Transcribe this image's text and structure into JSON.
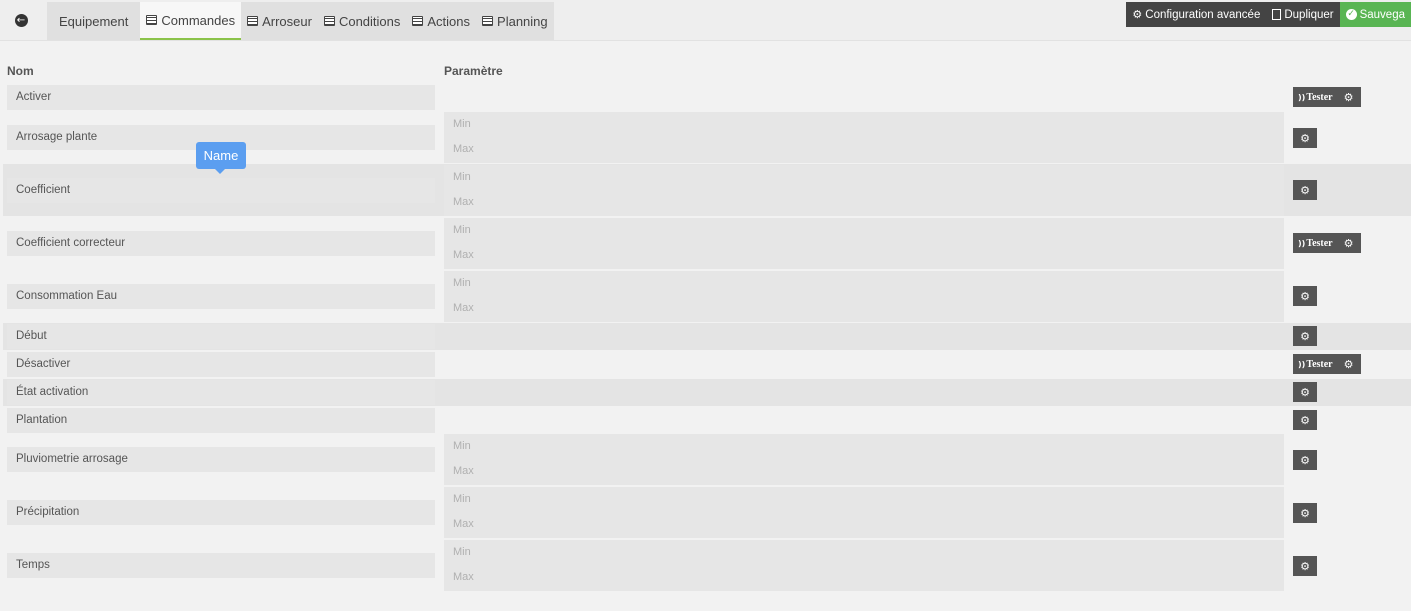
{
  "topbar": {
    "tabs": [
      {
        "label": "Equipement"
      },
      {
        "label": "Commandes"
      },
      {
        "label": "Arroseur"
      },
      {
        "label": "Conditions"
      },
      {
        "label": "Actions"
      },
      {
        "label": "Planning"
      }
    ],
    "buttons": {
      "config": "Configuration avancée",
      "duplicate": "Dupliquer",
      "save": "Sauvega"
    }
  },
  "table": {
    "col_name": "Nom",
    "col_param": "Paramètre",
    "test_label": "Tester",
    "min_placeholder": "Min",
    "max_placeholder": "Max",
    "rows": [
      {
        "name": "Activer"
      },
      {
        "name": "Arrosage plante"
      },
      {
        "name": "Coefficient"
      },
      {
        "name": "Coefficient correcteur"
      },
      {
        "name": "Consommation Eau"
      },
      {
        "name": "Début"
      },
      {
        "name": "Désactiver"
      },
      {
        "name": "État activation"
      },
      {
        "name": "Plantation"
      },
      {
        "name": "Pluviometrie arrosage"
      },
      {
        "name": "Précipitation"
      },
      {
        "name": "Temps"
      }
    ]
  },
  "tooltip": {
    "text": "Name"
  },
  "colors": {
    "accent": "#8bc34a",
    "save": "#59b553",
    "tooltip": "#5b9ef0",
    "button_dark": "#444444"
  }
}
